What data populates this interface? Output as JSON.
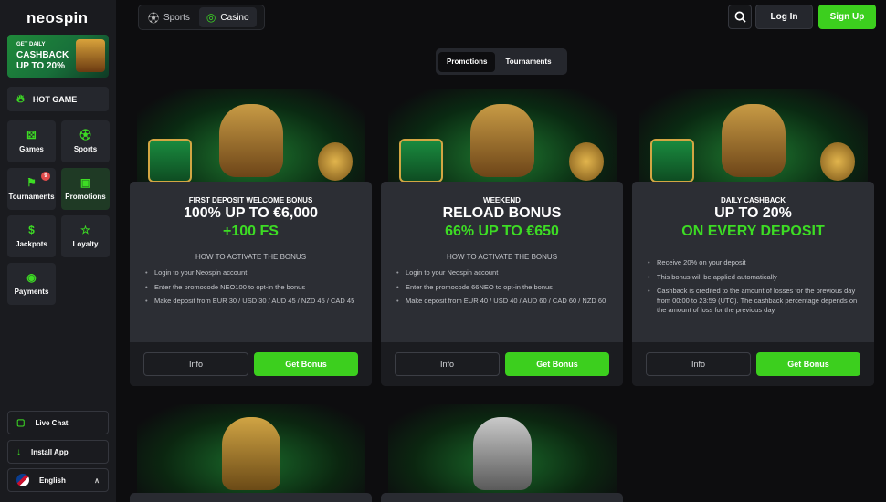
{
  "app": {
    "logo": "neospin"
  },
  "sidebar": {
    "banner": {
      "line1": "GET DAILY",
      "line2": "CASHBACK",
      "line3": "UP TO 20%"
    },
    "hot_game": "HOT GAME",
    "tiles": [
      {
        "label": "Games",
        "icon": "dice-icon"
      },
      {
        "label": "Sports",
        "icon": "soccer-ball-icon"
      },
      {
        "label": "Tournaments",
        "icon": "trophy-icon",
        "badge": "9"
      },
      {
        "label": "Promotions",
        "icon": "gift-icon"
      },
      {
        "label": "Jackpots",
        "icon": "money-bag-icon"
      },
      {
        "label": "Loyalty",
        "icon": "star-icon"
      },
      {
        "label": "Payments",
        "icon": "cash-icon"
      }
    ],
    "live_chat": "Live Chat",
    "install_app": "Install App",
    "language": "English"
  },
  "header": {
    "tabs": [
      "Sports",
      "Casino"
    ],
    "login": "Log In",
    "signup": "Sign Up"
  },
  "promo_tabs": [
    "Promotions",
    "Tournaments"
  ],
  "cards": [
    {
      "tag": "FIRST DEPOSIT WELCOME BONUS",
      "headline": "100% UP TO €6,000",
      "highlight": "+100 FS",
      "howto": "HOW TO ACTIVATE THE BONUS",
      "steps": [
        "Login to your Neospin account",
        "Enter the promocode NEO100 to opt-in the bonus",
        "Make deposit from EUR 30 / USD 30 / AUD 45 / NZD 45 / CAD 45"
      ],
      "info": "Info",
      "cta": "Get Bonus"
    },
    {
      "tag": "WEEKEND",
      "headline": "RELOAD BONUS",
      "highlight": "66% UP TO €650",
      "howto": "HOW TO ACTIVATE THE BONUS",
      "steps": [
        "Login to your Neospin account",
        "Enter the promocode 66NEO to opt-in the bonus",
        "Make deposit from EUR 40 / USD 40 / AUD 60 / CAD 60 / NZD 60"
      ],
      "info": "Info",
      "cta": "Get Bonus"
    },
    {
      "tag": "DAILY CASHBACK",
      "headline": "UP TO 20%",
      "highlight": "ON EVERY DEPOSIT",
      "howto": "",
      "steps": [
        "Receive 20% on your deposit",
        "This bonus will be applied automatically",
        "Cashback is credited to the amount of losses for the previous day from 00:00 to 23:59 (UTC). The cashback percentage depends on the amount of loss for the previous day."
      ],
      "info": "Info",
      "cta": "Get Bonus"
    }
  ],
  "colors": {
    "accent": "#3ccf1e",
    "panel": "#292b31",
    "background": "#0d0d0f"
  }
}
